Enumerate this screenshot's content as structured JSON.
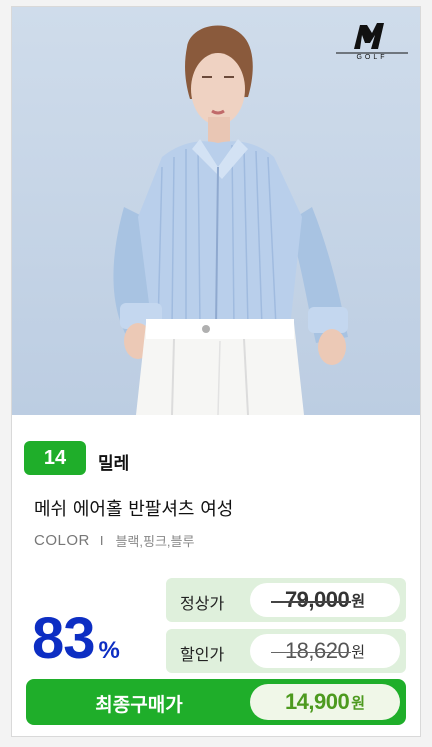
{
  "brand_logo": {
    "icon": "millet-logo-icon",
    "text": "GOLF"
  },
  "product": {
    "rank": "14",
    "brand": "밀레",
    "name": "메쉬 에어홀 반팔셔츠 여성",
    "color_label": "COLOR",
    "color_separator": "I",
    "colors": "블랙,핑크,블루"
  },
  "pricing": {
    "discount_value": "83",
    "discount_unit": "%",
    "regular_label": "정상가",
    "regular_price": "79,000",
    "sale_label": "할인가",
    "sale_price": "18,620",
    "final_label": "최종구매가",
    "final_price": "14,900",
    "currency": "원"
  },
  "colors": {
    "accent_green": "#1fae2a",
    "discount_blue": "#0d2ec3",
    "price_box_bg": "#dff0dc",
    "final_price_text": "#4d9a1f"
  }
}
